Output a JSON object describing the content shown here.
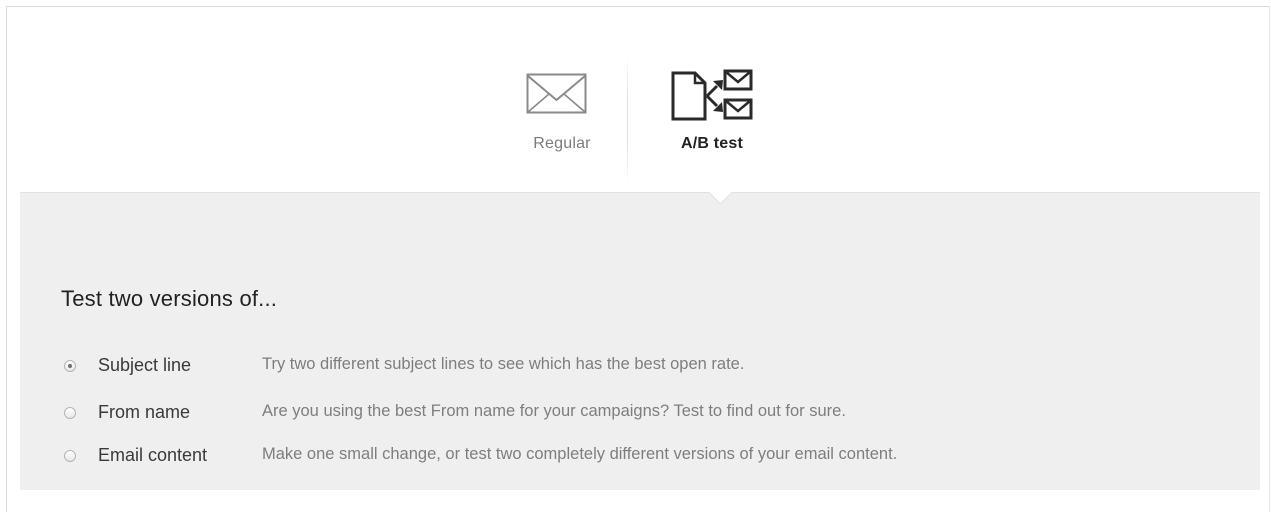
{
  "campaign_types": [
    {
      "label": "Regular",
      "icon": "envelope-icon",
      "selected": false
    },
    {
      "label": "A/B test",
      "icon": "ab-split-icon",
      "selected": true
    }
  ],
  "panel": {
    "title": "Test two versions of...",
    "options": [
      {
        "name": "Subject line",
        "description": "Try two different subject lines to see which has the best open rate.",
        "checked": true
      },
      {
        "name": "From name",
        "description": "Are you using the best From name for your campaigns? Test to find out for sure.",
        "checked": false
      },
      {
        "name": "Email content",
        "description": "Make one small change, or test two completely different versions of your email content.",
        "checked": false
      }
    ]
  },
  "colors": {
    "panel_background": "#efefef",
    "selected_label": "#222222",
    "unselected_label": "#7c7c7c",
    "description_text": "#7e7e7e"
  }
}
